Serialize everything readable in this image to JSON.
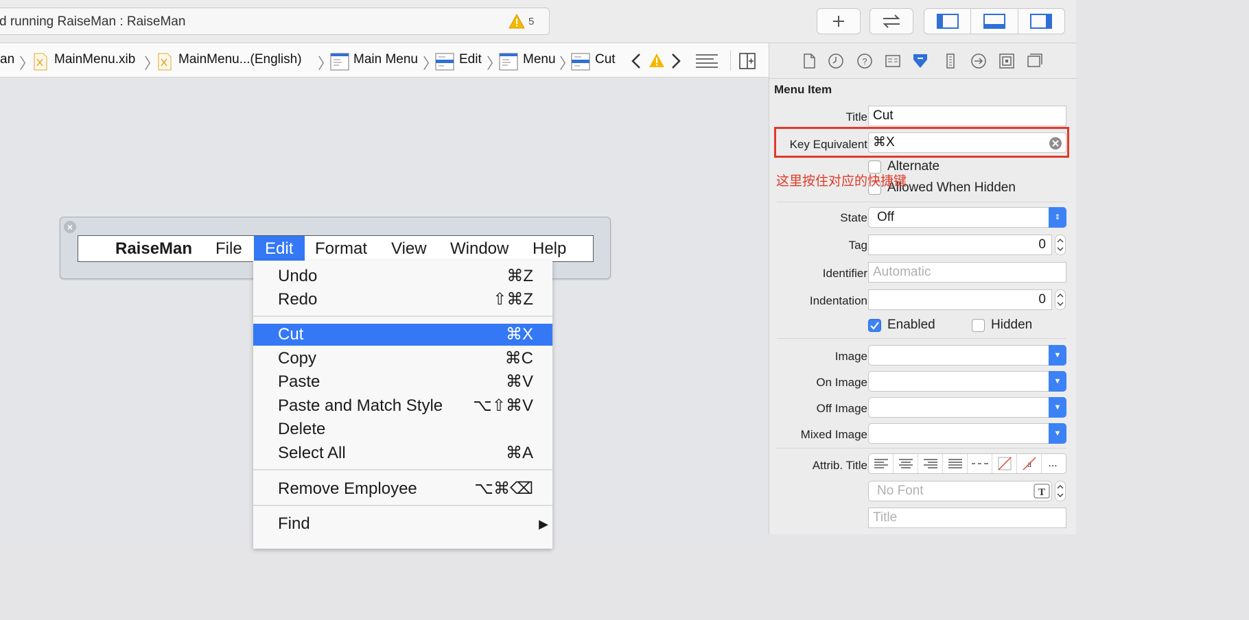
{
  "toolbar": {
    "activity_text": "d running RaiseMan : RaiseMan",
    "warning_count": "5",
    "buttons": [
      "plus-icon",
      "swap-arrows-icon"
    ],
    "panel_toggles": [
      "navigator-panel-icon",
      "debug-panel-icon",
      "inspector-panel-icon"
    ]
  },
  "jumpbar": {
    "crumbs": [
      "an",
      "MainMenu.xib",
      "MainMenu...(English)",
      "Main Menu",
      "Edit",
      "Menu",
      "Cut"
    ]
  },
  "menu_editor": {
    "menubar": [
      {
        "label": "RaiseMan"
      },
      {
        "label": "File"
      },
      {
        "label": "Edit"
      },
      {
        "label": "Format"
      },
      {
        "label": "View"
      },
      {
        "label": "Window"
      },
      {
        "label": "Help"
      }
    ],
    "edit_menu": [
      {
        "label": "Undo",
        "shortcut": "⌘Z"
      },
      {
        "label": "Redo",
        "shortcut": "⇧⌘Z"
      },
      {
        "label": "Cut",
        "shortcut": "⌘X"
      },
      {
        "label": "Copy",
        "shortcut": "⌘C"
      },
      {
        "label": "Paste",
        "shortcut": "⌘V"
      },
      {
        "label": "Paste and Match Style",
        "shortcut": "⌥⇧⌘V"
      },
      {
        "label": "Delete",
        "shortcut": ""
      },
      {
        "label": "Select All",
        "shortcut": "⌘A"
      },
      {
        "label": "Remove Employee",
        "shortcut": "⌥⌘⌫"
      },
      {
        "label": "Find",
        "shortcut": "▶"
      }
    ]
  },
  "inspector": {
    "section_title": "Menu Item",
    "title_label": "Title",
    "title_value": "Cut",
    "key_equivalent_label": "Key Equivalent",
    "key_equivalent_value": "⌘X",
    "annotation": "这里按住对应的快捷键",
    "alternate_label": "Alternate",
    "allowed_hidden_label": "Allowed When Hidden",
    "state_label": "State",
    "state_value": "Off",
    "tag_label": "Tag",
    "tag_value": "0",
    "identifier_label": "Identifier",
    "identifier_placeholder": "Automatic",
    "indentation_label": "Indentation",
    "indentation_value": "0",
    "enabled_label": "Enabled",
    "hidden_label": "Hidden",
    "image_label": "Image",
    "on_image_label": "On Image",
    "off_image_label": "Off Image",
    "mixed_image_label": "Mixed Image",
    "attrib_title_label": "Attrib. Title",
    "font_placeholder": "No Font",
    "title_placeholder": "Title",
    "more_label": "...",
    "accent": "#3478f6",
    "annotation_color": "#e03a2a"
  }
}
